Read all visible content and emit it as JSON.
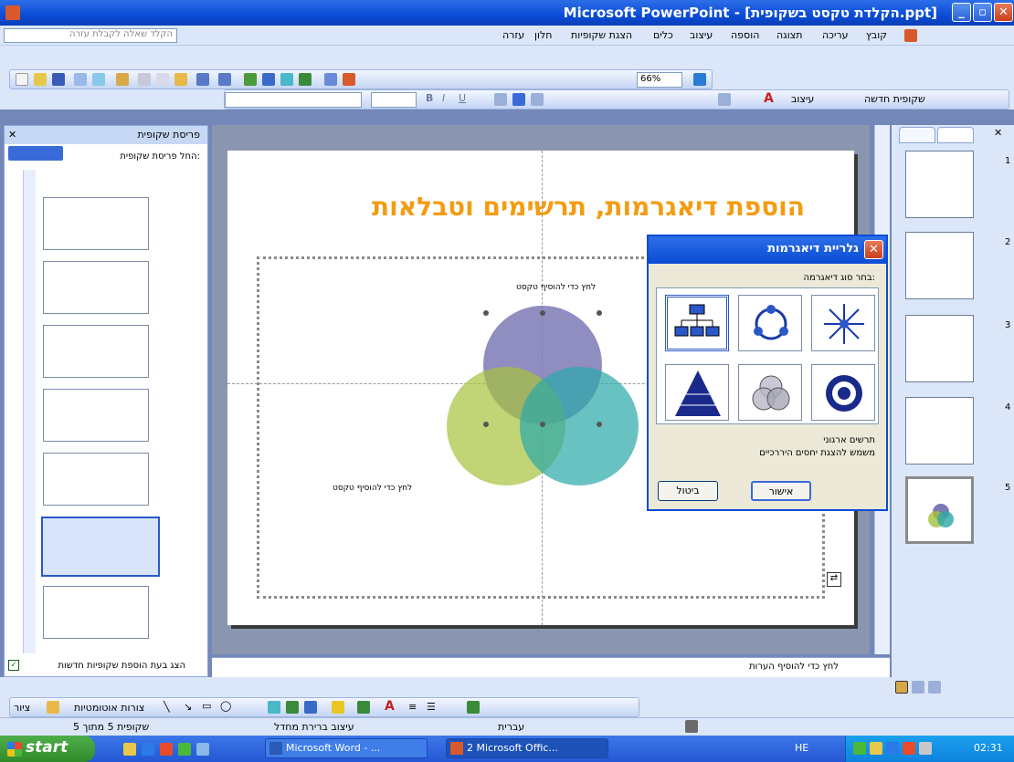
{
  "window": {
    "title": "Microsoft PowerPoint - [הקלדת טקסט בשקופית.ppt]"
  },
  "menu": [
    "קובץ",
    "עריכה",
    "תצוגה",
    "הוספה",
    "עיצוב",
    "כלים",
    "הצגת שקופיות",
    "חלון",
    "עזרה"
  ],
  "help_box_placeholder": "הקלד שאלה לקבלת עזרה",
  "toolbar": {
    "zoom": "66%",
    "design_label": "עיצוב",
    "new_slide_label": "שקופית חדשה"
  },
  "task_pane": {
    "title": "פריסת שקופית",
    "apply_label": "החל פריסת שקופית:",
    "show_on_insert": "הצג בעת הוספת שקופיות חדשות"
  },
  "slide": {
    "title": "הוספת דיאגרמות, תרשימים וטבלאות",
    "text_placeholder_1": "לחץ כדי להוסיף טקסט",
    "text_placeholder_2": "לחץ כדי להוסיף טקסט"
  },
  "notes_placeholder": "לחץ כדי להוסיף הערות",
  "dialog": {
    "title": "גלריית דיאגרמות",
    "prompt": "בחר סוג דיאגרמה:",
    "selected_name": "תרשים ארגוני",
    "selected_desc": "משמש להצגת יחסים היררכיים",
    "ok": "אישור",
    "cancel": "ביטול",
    "tiles": [
      "org-chart",
      "cycle",
      "radial",
      "pyramid",
      "venn",
      "target"
    ]
  },
  "slides_pane": {
    "numbers": [
      "1",
      "2",
      "3",
      "4",
      "5"
    ]
  },
  "drawing_toolbar": {
    "draw_label": "ציור",
    "autoshapes_label": "צורות אוטומטיות"
  },
  "status": {
    "slide_counter": "שקופית 5 מתוך 5",
    "design": "עיצוב ברירת מחדל",
    "language": "עברית"
  },
  "taskbar": {
    "start": "start",
    "tasks": [
      "Microsoft Word - ...",
      "2 Microsoft Offic..."
    ],
    "lang": "HE",
    "time": "02:31"
  }
}
